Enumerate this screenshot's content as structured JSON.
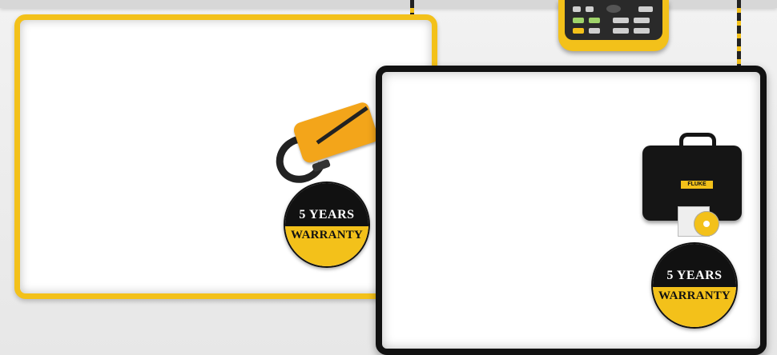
{
  "badges": [
    {
      "years": "5 YEARS",
      "warranty": "WARRANTY"
    },
    {
      "years": "5 YEARS",
      "warranty": "WARRANTY"
    }
  ],
  "case_brand": "FLUKE",
  "colors": {
    "accent": "#f3c11a",
    "panel_dark": "#111111"
  }
}
